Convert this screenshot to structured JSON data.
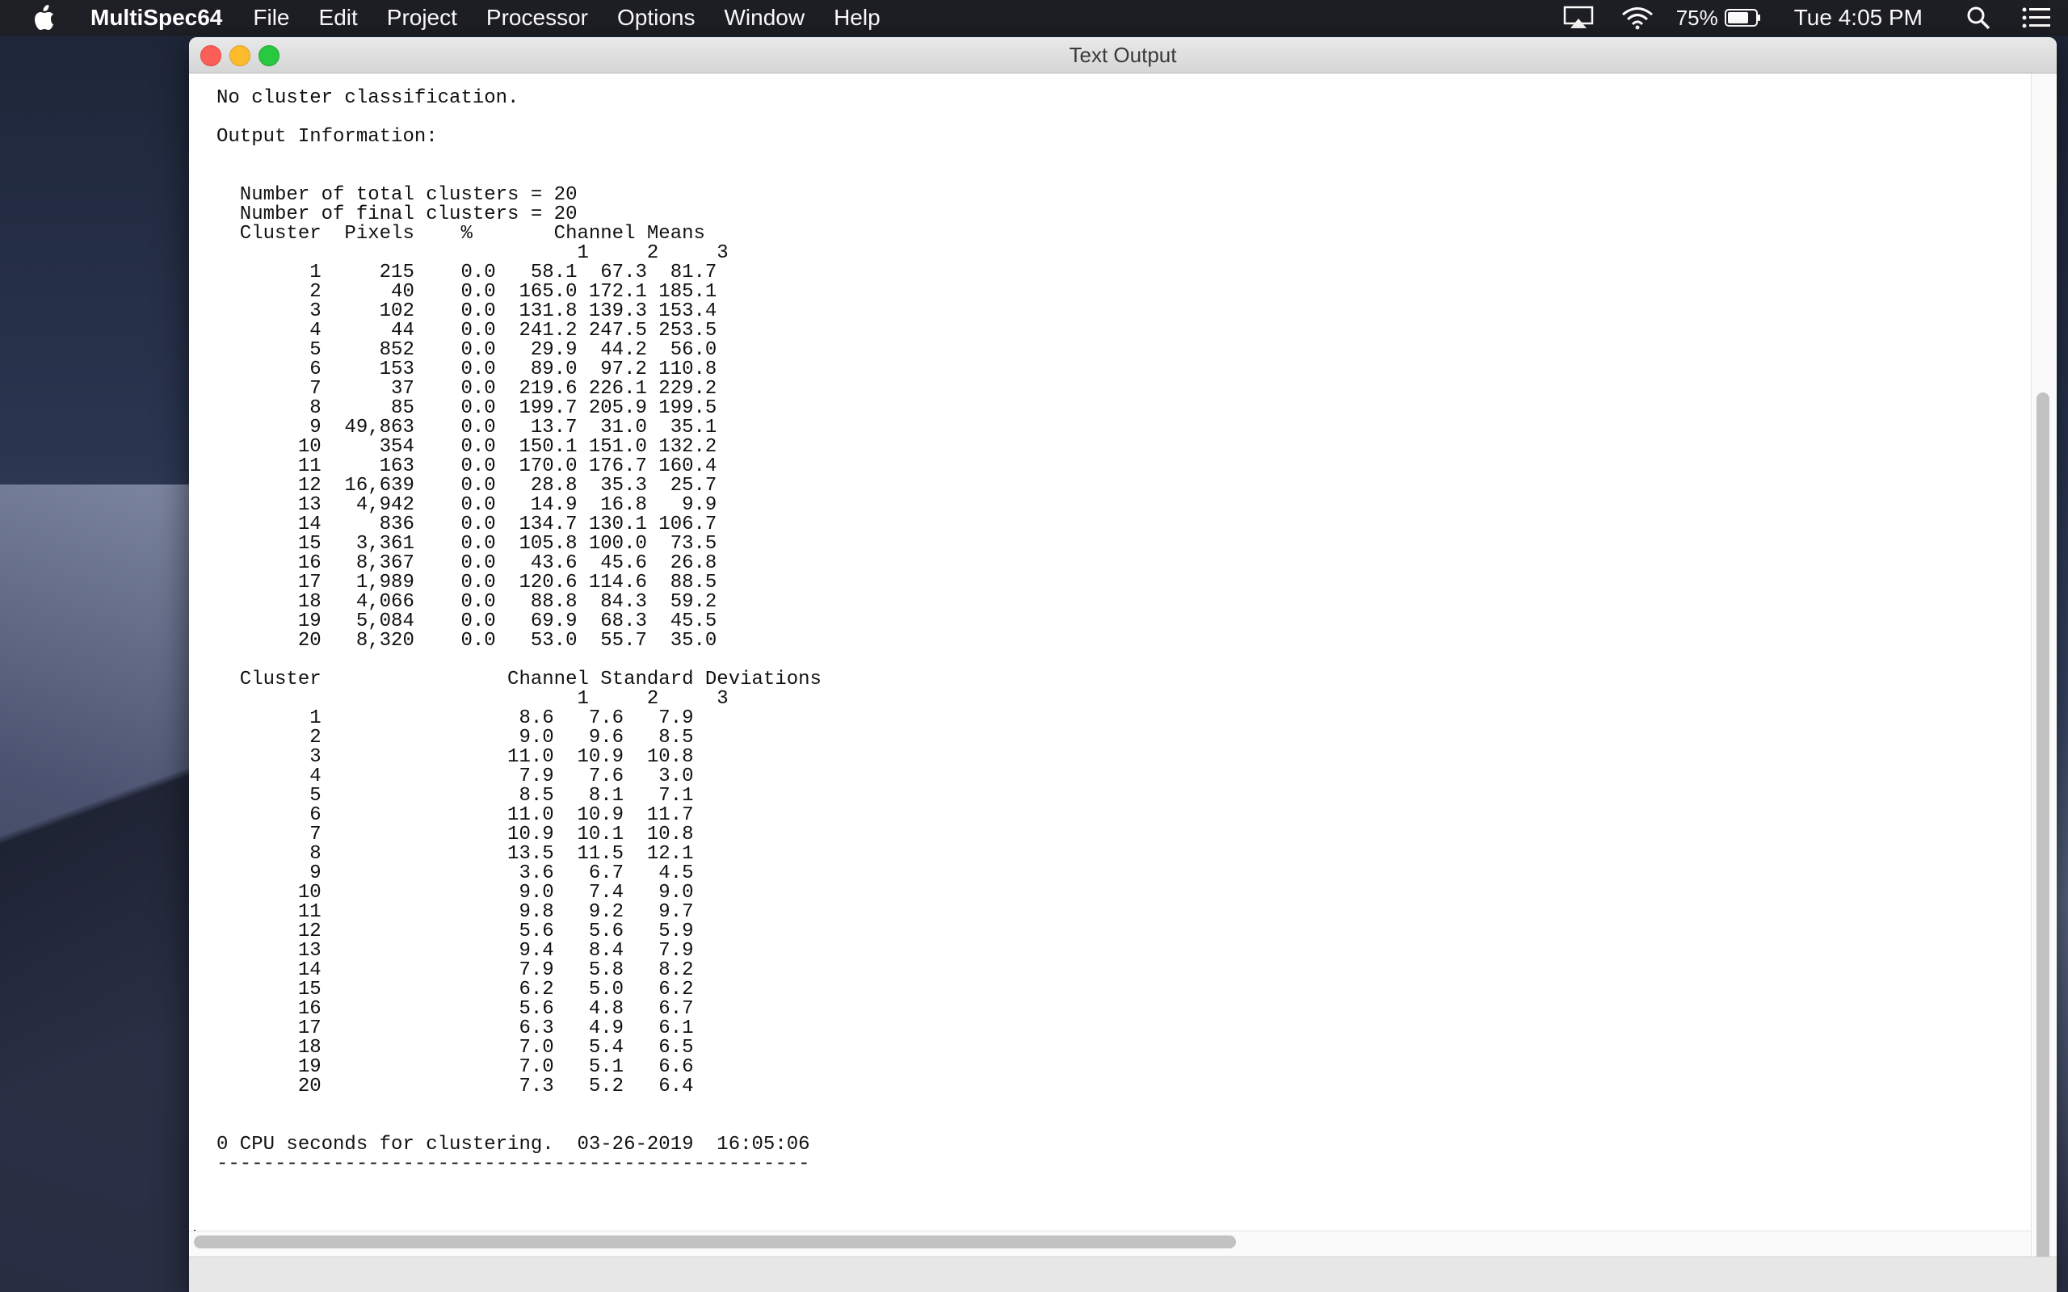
{
  "menubar": {
    "app_name": "MultiSpec64",
    "items": [
      "File",
      "Edit",
      "Project",
      "Processor",
      "Options",
      "Window",
      "Help"
    ],
    "battery": "75%",
    "clock": "Tue 4:05 PM",
    "icons": [
      "apple-icon",
      "airplay-icon",
      "wifi-icon",
      "battery-icon",
      "spotlight-search-icon",
      "notification-center-icon"
    ]
  },
  "window": {
    "title": "Text Output"
  },
  "output": {
    "text": "No cluster classification.\n\nOutput Information:\n\n\n  Number of total clusters = 20\n  Number of final clusters = 20\n  Cluster  Pixels    %       Channel Means\n                               1     2     3\n        1     215    0.0   58.1  67.3  81.7\n        2      40    0.0  165.0 172.1 185.1\n        3     102    0.0  131.8 139.3 153.4\n        4      44    0.0  241.2 247.5 253.5\n        5     852    0.0   29.9  44.2  56.0\n        6     153    0.0   89.0  97.2 110.8\n        7      37    0.0  219.6 226.1 229.2\n        8      85    0.0  199.7 205.9 199.5\n        9  49,863    0.0   13.7  31.0  35.1\n       10     354    0.0  150.1 151.0 132.2\n       11     163    0.0  170.0 176.7 160.4\n       12  16,639    0.0   28.8  35.3  25.7\n       13   4,942    0.0   14.9  16.8   9.9\n       14     836    0.0  134.7 130.1 106.7\n       15   3,361    0.0  105.8 100.0  73.5\n       16   8,367    0.0   43.6  45.6  26.8\n       17   1,989    0.0  120.6 114.6  88.5\n       18   4,066    0.0   88.8  84.3  59.2\n       19   5,084    0.0   69.9  68.3  45.5\n       20   8,320    0.0   53.0  55.7  35.0\n\n  Cluster                Channel Standard Deviations\n                               1     2     3\n        1                 8.6   7.6   7.9\n        2                 9.0   9.6   8.5\n        3                11.0  10.9  10.8\n        4                 7.9   7.6   3.0\n        5                 8.5   8.1   7.1\n        6                11.0  10.9  11.7\n        7                10.9  10.1  10.8\n        8                13.5  11.5  12.1\n        9                 3.6   6.7   4.5\n       10                 9.0   7.4   9.0\n       11                 9.8   9.2   9.7\n       12                 5.6   5.6   5.9\n       13                 9.4   8.4   7.9\n       14                 7.9   5.8   8.2\n       15                 6.2   5.0   6.2\n       16                 5.6   4.8   6.7\n       17                 6.3   4.9   6.1\n       18                 7.0   5.4   6.5\n       19                 7.0   5.1   6.6\n       20                 7.3   5.2   6.4\n\n\n0 CPU seconds for clustering.  03-26-2019  16:05:06\n---------------------------------------------------"
  }
}
